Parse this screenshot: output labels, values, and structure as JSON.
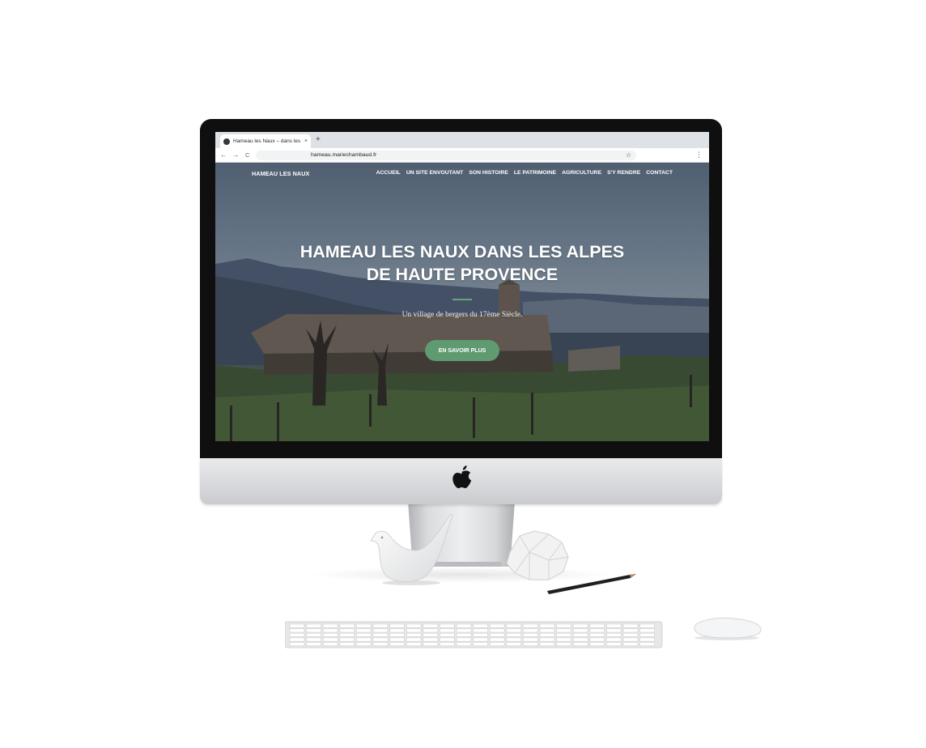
{
  "browser": {
    "tab_title": "Hameau les Naux – dans les alpes",
    "tab_close": "×",
    "new_tab": "+",
    "back": "←",
    "forward": "→",
    "reload": "C",
    "url": "hameau.mariechambaud.fr",
    "bookmark_icon": "☆",
    "menu_icon": "⋮"
  },
  "site": {
    "brand": "HAMEAU LES NAUX",
    "nav": [
      {
        "label": "ACCUEIL"
      },
      {
        "label": "UN SITE ENVOUTANT"
      },
      {
        "label": "SON HISTOIRE"
      },
      {
        "label": "LE PATRIMOINE"
      },
      {
        "label": "AGRICULTURE"
      },
      {
        "label": "S'Y RENDRE"
      },
      {
        "label": "CONTACT"
      }
    ],
    "hero": {
      "title_line1": "HAMEAU LES NAUX DANS LES ALPES",
      "title_line2": "DE HAUTE PROVENCE",
      "subtitle": "Un village de bergers du 17ème Siècle.",
      "cta": "EN SAVOIR PLUS"
    }
  },
  "colors": {
    "accent_green": "#5f9a71",
    "tab_bar": "#dee1e6",
    "bezel": "#0f0f10"
  }
}
